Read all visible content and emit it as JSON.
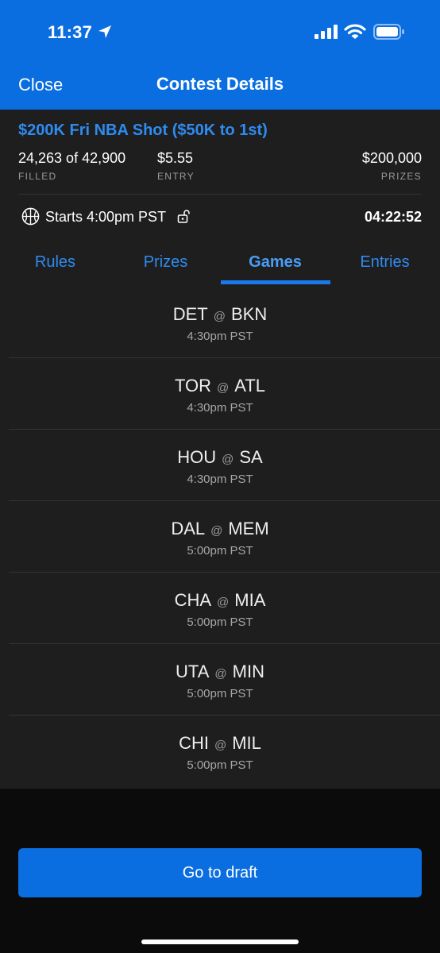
{
  "status_bar": {
    "time": "11:37",
    "icons": [
      "location-arrow-icon",
      "cellular-signal-icon",
      "wifi-icon",
      "battery-icon"
    ]
  },
  "nav": {
    "close_label": "Close",
    "title": "Contest Details"
  },
  "contest": {
    "name": "$200K Fri NBA Shot ($50K to 1st)",
    "filled_value": "24,263 of 42,900",
    "filled_label": "FILLED",
    "entry_value": "$5.55",
    "entry_label": "ENTRY",
    "prizes_value": "$200,000",
    "prizes_label": "PRIZES",
    "starts": "Starts 4:00pm PST",
    "countdown": "04:22:52"
  },
  "tabs": [
    {
      "label": "Rules",
      "active": false
    },
    {
      "label": "Prizes",
      "active": false
    },
    {
      "label": "Games",
      "active": true
    },
    {
      "label": "Entries",
      "active": false
    }
  ],
  "games": [
    {
      "away": "DET",
      "at": "@",
      "home": "BKN",
      "time": "4:30pm PST"
    },
    {
      "away": "TOR",
      "at": "@",
      "home": "ATL",
      "time": "4:30pm PST"
    },
    {
      "away": "HOU",
      "at": "@",
      "home": "SA",
      "time": "4:30pm PST"
    },
    {
      "away": "DAL",
      "at": "@",
      "home": "MEM",
      "time": "5:00pm PST"
    },
    {
      "away": "CHA",
      "at": "@",
      "home": "MIA",
      "time": "5:00pm PST"
    },
    {
      "away": "UTA",
      "at": "@",
      "home": "MIN",
      "time": "5:00pm PST"
    },
    {
      "away": "CHI",
      "at": "@",
      "home": "MIL",
      "time": "5:00pm PST"
    }
  ],
  "draft_button_label": "Go to draft",
  "colors": {
    "brand_blue": "#0a6ee0",
    "link_blue": "#2f8bf0",
    "panel_bg": "#1e1e1e",
    "page_bg": "#0b0b0b"
  }
}
